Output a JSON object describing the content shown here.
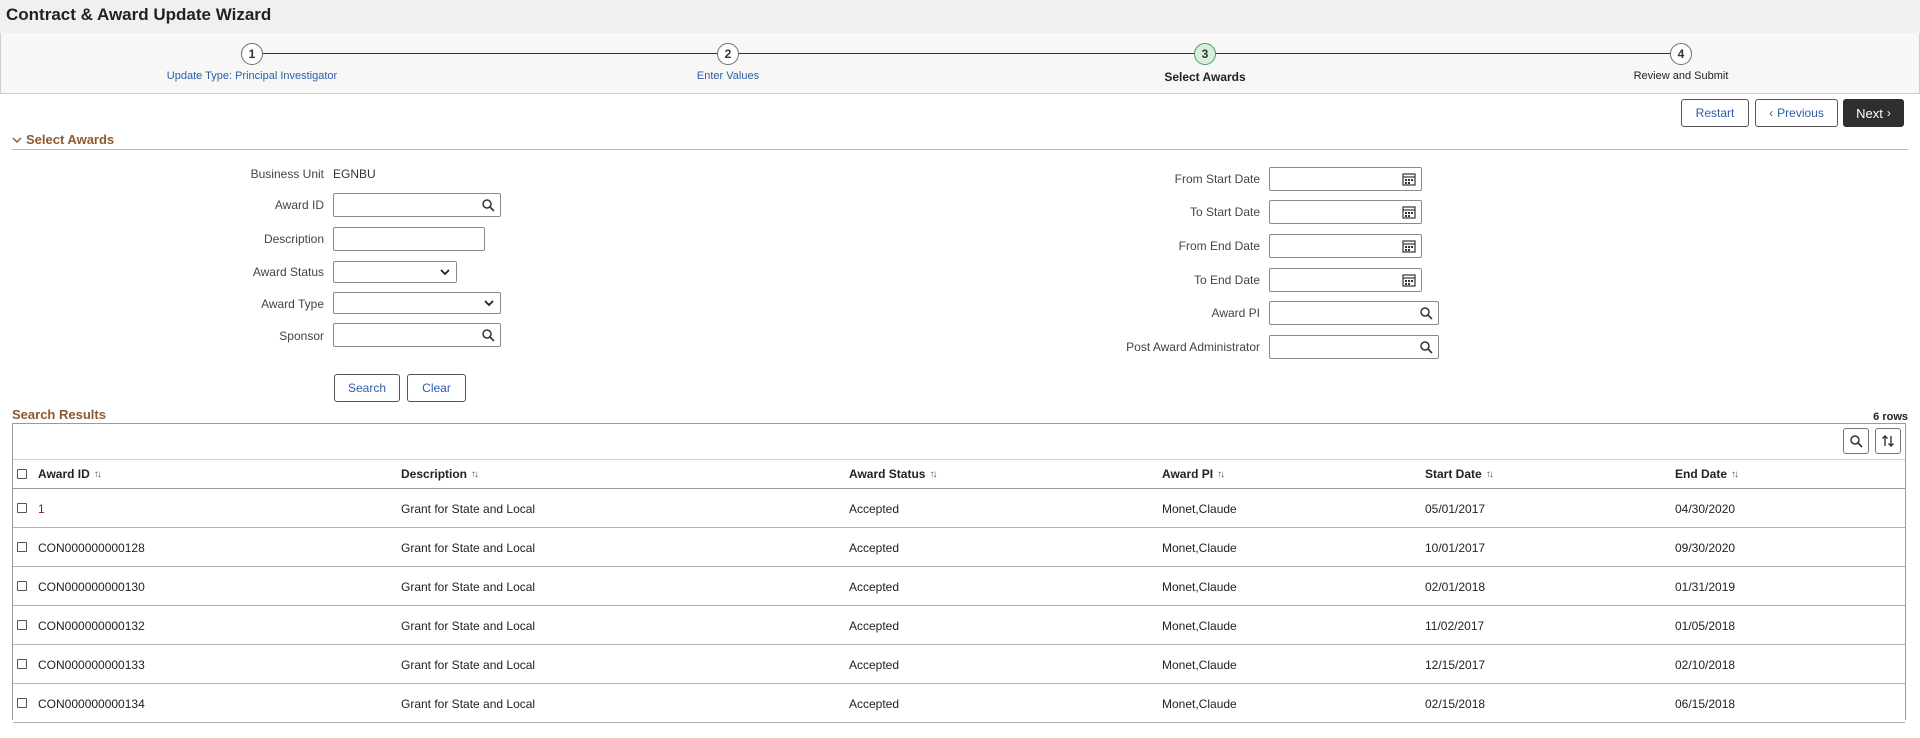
{
  "page": {
    "title": "Contract & Award Update Wizard"
  },
  "steps": [
    {
      "number": "1",
      "label": "Update Type: Principal Investigator"
    },
    {
      "number": "2",
      "label": "Enter Values"
    },
    {
      "number": "3",
      "label": "Select Awards"
    },
    {
      "number": "4",
      "label": "Review and Submit"
    }
  ],
  "nav": {
    "restart": "Restart",
    "previous": "Previous",
    "next": "Next"
  },
  "section": {
    "title": "Select Awards"
  },
  "form": {
    "business_unit_label": "Business Unit",
    "business_unit_value": "EGNBU",
    "award_id_label": "Award ID",
    "award_id_value": "",
    "description_label": "Description",
    "description_value": "",
    "award_status_label": "Award Status",
    "award_status_value": "",
    "award_type_label": "Award Type",
    "award_type_value": "",
    "sponsor_label": "Sponsor",
    "sponsor_value": "",
    "from_start_date_label": "From Start Date",
    "to_start_date_label": "To Start Date",
    "from_end_date_label": "From End Date",
    "to_end_date_label": "To End Date",
    "award_pi_label": "Award PI",
    "post_award_admin_label": "Post Award Administrator",
    "search_button": "Search",
    "clear_button": "Clear"
  },
  "results": {
    "title": "Search Results",
    "row_count": "6 rows",
    "columns": [
      "Award ID",
      "Description",
      "Award Status",
      "Award PI",
      "Start Date",
      "End Date"
    ],
    "rows": [
      [
        "1",
        "Grant for State and Local",
        "Accepted",
        "Monet,Claude",
        "05/01/2017",
        "04/30/2020"
      ],
      [
        "CON000000000128",
        "Grant for State and Local",
        "Accepted",
        "Monet,Claude",
        "10/01/2017",
        "09/30/2020"
      ],
      [
        "CON000000000130",
        "Grant for State and Local",
        "Accepted",
        "Monet,Claude",
        "02/01/2018",
        "01/31/2019"
      ],
      [
        "CON000000000132",
        "Grant for State and Local",
        "Accepted",
        "Monet,Claude",
        "11/02/2017",
        "01/05/2018"
      ],
      [
        "CON000000000133",
        "Grant for State and Local",
        "Accepted",
        "Monet,Claude",
        "12/15/2017",
        "02/10/2018"
      ],
      [
        "CON000000000134",
        "Grant for State and Local",
        "Accepted",
        "Monet,Claude",
        "02/15/2018",
        "06/15/2018"
      ]
    ]
  },
  "icons": {
    "lookup": "magnifier-icon",
    "calendar": "calendar-icon",
    "dropdown": "chevron-down-icon",
    "sort": "sort-arrows-icon"
  },
  "colors": {
    "accent": "#8c5a32",
    "link": "#2b5ea8",
    "primary_button": "#2f2f2f",
    "current_step": "#d6efdd"
  }
}
